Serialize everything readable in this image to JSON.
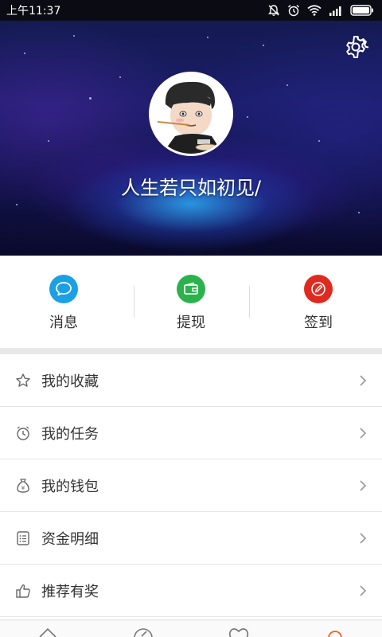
{
  "status_bar": {
    "time": "上午11:37"
  },
  "header": {
    "username": "人生若只如初见/",
    "settings_icon": "gear-icon"
  },
  "quick_actions": [
    {
      "label": "消息",
      "icon": "chat-bubble-icon",
      "color": "#1aa0e6"
    },
    {
      "label": "提现",
      "icon": "wallet-icon",
      "color": "#2bb24c"
    },
    {
      "label": "签到",
      "icon": "pencil-icon",
      "color": "#e02a1f"
    }
  ],
  "menu": [
    {
      "label": "我的收藏",
      "icon": "star-icon"
    },
    {
      "label": "我的任务",
      "icon": "clock-icon"
    },
    {
      "label": "我的钱包",
      "icon": "money-bag-icon"
    },
    {
      "label": "资金明细",
      "icon": "list-detail-icon"
    },
    {
      "label": "推荐有奖",
      "icon": "thumbs-up-icon"
    }
  ],
  "bottom_nav": [
    {
      "icon": "home-icon"
    },
    {
      "icon": "compass-icon"
    },
    {
      "icon": "heart-icon"
    },
    {
      "icon": "profile-icon",
      "active_color": "#ff5a1f"
    }
  ]
}
